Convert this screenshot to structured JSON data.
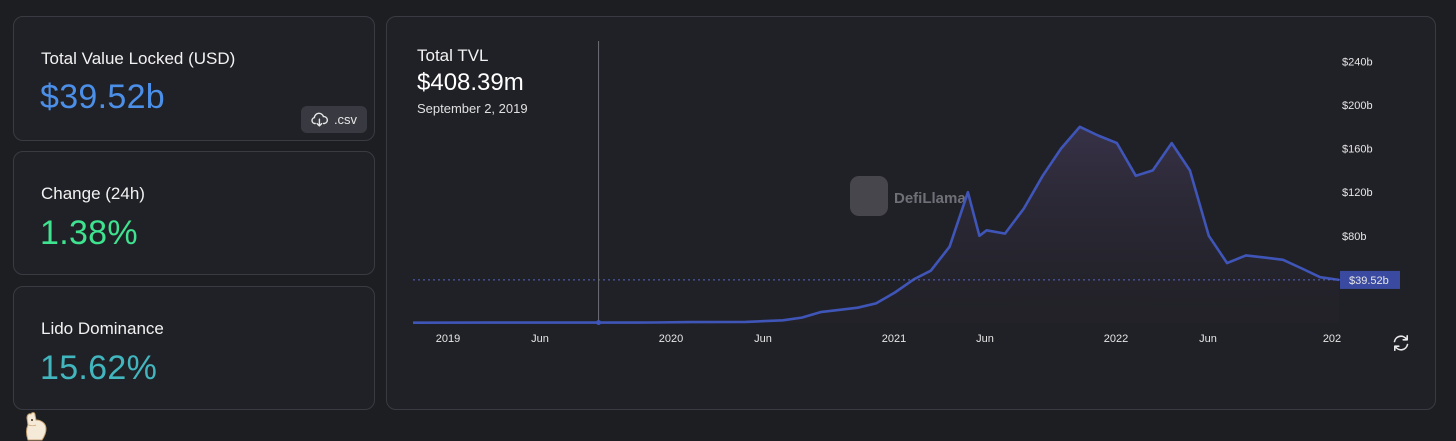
{
  "tvl_card": {
    "label": "Total Value Locked (USD)",
    "value": "$39.52b",
    "csv_label": ".csv",
    "value_color": "#4b8fe8"
  },
  "change_card": {
    "label": "Change (24h)",
    "value": "1.38%",
    "value_color": "#3ee28f"
  },
  "dominance_card": {
    "label": "Lido Dominance",
    "value": "15.62%",
    "value_color": "#42b6bf"
  },
  "tooltip": {
    "title": "Total TVL",
    "value": "$408.39m",
    "date": "September 2, 2019"
  },
  "watermark": "DefiLlama",
  "icons": {
    "csv": "cloud-download-icon",
    "refresh": "refresh-icon",
    "logo": "llama-logo-icon"
  },
  "chart_data": {
    "type": "area",
    "series": [
      {
        "color": "#3f55b8",
        "points": [
          [
            "2018-11",
            0.3
          ],
          [
            "2019-03",
            0.35
          ],
          [
            "2019-06",
            0.4
          ],
          [
            "2019-09",
            0.41
          ],
          [
            "2019-12",
            0.5
          ],
          [
            "2020-02",
            0.8
          ],
          [
            "2020-05",
            1.0
          ],
          [
            "2020-07",
            2.5
          ],
          [
            "2020-08",
            5
          ],
          [
            "2020-09",
            10
          ],
          [
            "2020-10",
            12
          ],
          [
            "2020-11",
            14
          ],
          [
            "2020-12",
            18
          ],
          [
            "2021-01",
            28
          ],
          [
            "2021-02",
            40
          ],
          [
            "2021-03",
            48
          ],
          [
            "2021-04",
            70
          ],
          [
            "2021-05",
            120
          ],
          [
            "2021-05-20",
            80
          ],
          [
            "2021-06",
            85
          ],
          [
            "2021-07",
            82
          ],
          [
            "2021-08",
            105
          ],
          [
            "2021-09",
            135
          ],
          [
            "2021-10",
            160
          ],
          [
            "2021-11",
            180
          ],
          [
            "2021-12",
            172
          ],
          [
            "2022-01",
            165
          ],
          [
            "2022-02",
            135
          ],
          [
            "2022-03",
            140
          ],
          [
            "2022-04",
            165
          ],
          [
            "2022-05",
            140
          ],
          [
            "2022-06",
            80
          ],
          [
            "2022-07",
            55
          ],
          [
            "2022-08",
            62
          ],
          [
            "2022-09",
            60
          ],
          [
            "2022-10",
            58
          ],
          [
            "2022-11",
            50
          ],
          [
            "2022-12",
            42
          ],
          [
            "2023-01",
            39.52
          ]
        ]
      }
    ],
    "x_ticks": [
      "2019",
      "Jun",
      "2020",
      "Jun",
      "2021",
      "Jun",
      "2022",
      "Jun",
      "202"
    ],
    "y_ticks": [
      "$80b",
      "$120b",
      "$160b",
      "$200b",
      "$240b"
    ],
    "ylim": [
      0,
      240
    ],
    "current_value_label": "$39.52b",
    "current_value": 39.52,
    "hover_date": "2019-09-02",
    "hover_value": 0.40839
  }
}
